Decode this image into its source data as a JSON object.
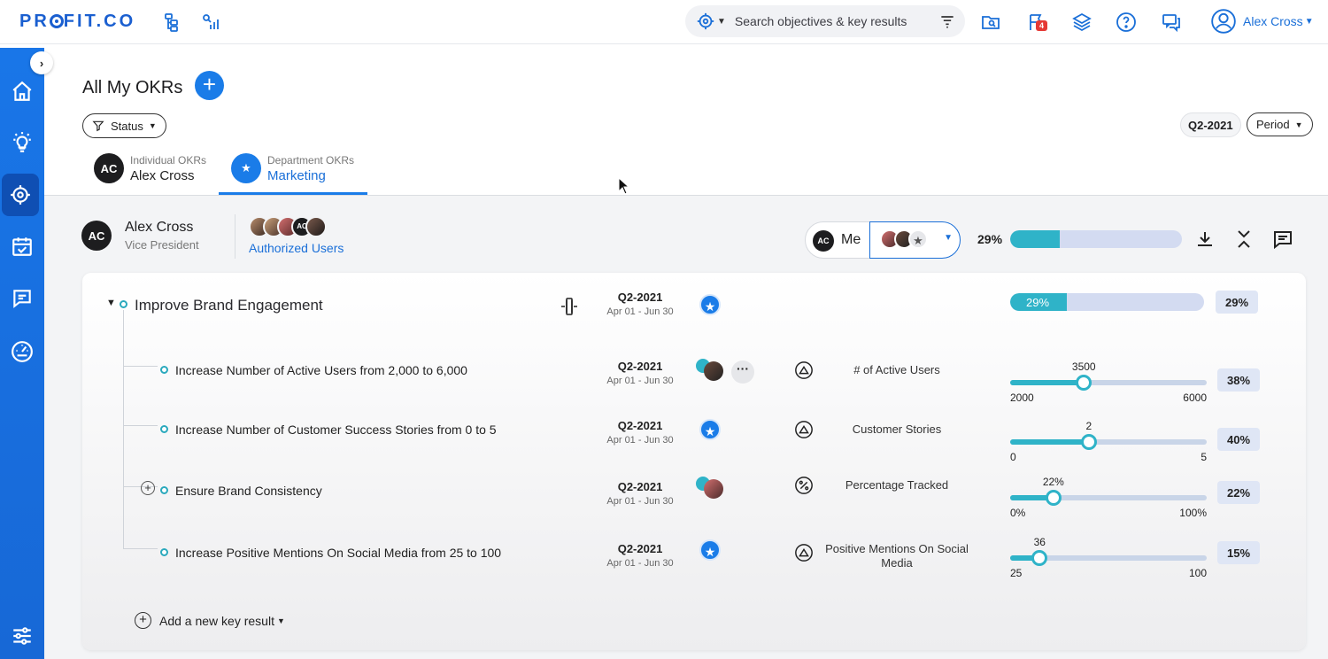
{
  "app": {
    "logo_text": "PROFIT.CO",
    "brand_color": "#1a6fd8",
    "accent_teal": "#2fb3c8"
  },
  "topbar": {
    "search_placeholder": "Search objectives & key results",
    "notifications_count": "4",
    "user_name": "Alex Cross",
    "icons": [
      "hierarchy-icon",
      "analytics-icon",
      "folder-search-icon",
      "flag-icon",
      "layers-icon",
      "help-icon",
      "chat-icon",
      "user-icon"
    ]
  },
  "sidebar": {
    "items": [
      "home-icon",
      "idea-icon",
      "target-icon",
      "calendar-check-icon",
      "feedback-icon",
      "dashboard-gauge-icon",
      "settings-sliders-icon"
    ],
    "active": "target-icon"
  },
  "header": {
    "title": "All My OKRs",
    "status_filter": "Status",
    "quarter": "Q2-2021",
    "period": "Period"
  },
  "tabs": [
    {
      "initials": "AC",
      "label": "Individual OKRs",
      "name": "Alex Cross"
    },
    {
      "initials": "★",
      "label": "Department OKRs",
      "name": "Marketing"
    }
  ],
  "owner": {
    "initials": "AC",
    "name": "Alex Cross",
    "role": "Vice President",
    "authorized_label": "Authorized Users",
    "authorized_initials": "AC"
  },
  "toggle": {
    "me_initials": "AC",
    "me_label": "Me"
  },
  "overall": {
    "percent_label": "29%",
    "progress": 29
  },
  "objective": {
    "title": "Improve Brand Engagement",
    "quarter": "Q2-2021",
    "dates": "Apr 01 - Jun 30",
    "progress": 29,
    "progress_label": "29%",
    "percent": "29%"
  },
  "key_results": [
    {
      "title": "Increase Number of Active Users from 2,000 to 6,000",
      "quarter": "Q2-2021",
      "dates": "Apr 01 - Jun 30",
      "metric": "# of Active Users",
      "min": "2000",
      "max": "6000",
      "current": "3500",
      "fraction": 0.375,
      "percent": "38%"
    },
    {
      "title": "Increase Number of Customer Success Stories from 0 to 5",
      "quarter": "Q2-2021",
      "dates": "Apr 01 - Jun 30",
      "metric": "Customer Stories",
      "min": "0",
      "max": "5",
      "current": "2",
      "fraction": 0.4,
      "percent": "40%"
    },
    {
      "title": "Ensure Brand Consistency",
      "quarter": "Q2-2021",
      "dates": "Apr 01 - Jun 30",
      "metric": "Percentage Tracked",
      "min": "0%",
      "max": "100%",
      "current": "22%",
      "fraction": 0.22,
      "percent": "22%"
    },
    {
      "title": "Increase Positive Mentions On Social Media from 25 to 100",
      "quarter": "Q2-2021",
      "dates": "Apr 01 - Jun 30",
      "metric": "Positive Mentions On Social Media",
      "min": "25",
      "max": "100",
      "current": "36",
      "fraction": 0.15,
      "percent": "15%"
    }
  ],
  "add_key_result": "Add a new key result"
}
